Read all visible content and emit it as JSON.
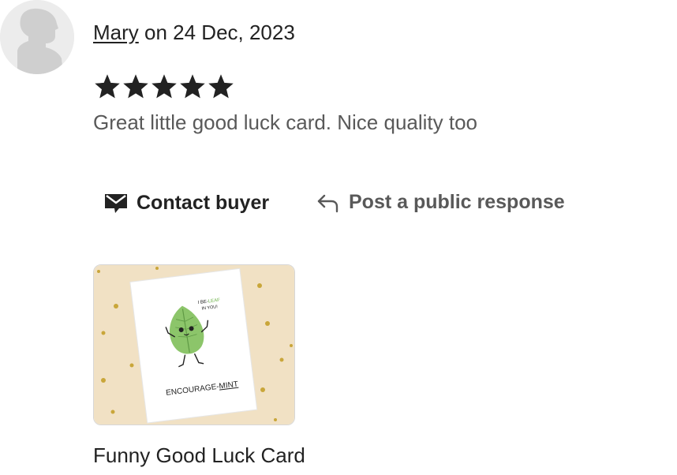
{
  "review": {
    "reviewer_name": "Mary",
    "date_text": " on 24 Dec, 2023",
    "rating": 5,
    "rating_max": 5,
    "text": "Great little good luck card. Nice quality too"
  },
  "actions": {
    "contact_label": "Contact buyer",
    "contact_icon": "envelope-icon",
    "respond_label": "Post a public response",
    "respond_icon": "reply-arrow-icon"
  },
  "product": {
    "title": "Funny Good Luck Card",
    "card_text_top_1": "I BE-",
    "card_text_top_1b": "LEAF",
    "card_text_top_2": "IN YOU!",
    "card_text_bottom_a": "ENCOURAGE-",
    "card_text_bottom_b": "MINT"
  },
  "colors": {
    "text_primary": "#222222",
    "text_secondary": "#595959",
    "star": "#222222",
    "leaf": "#8cc56a",
    "card_bg": "#f1e1c4",
    "dot": "#c9a63a"
  }
}
